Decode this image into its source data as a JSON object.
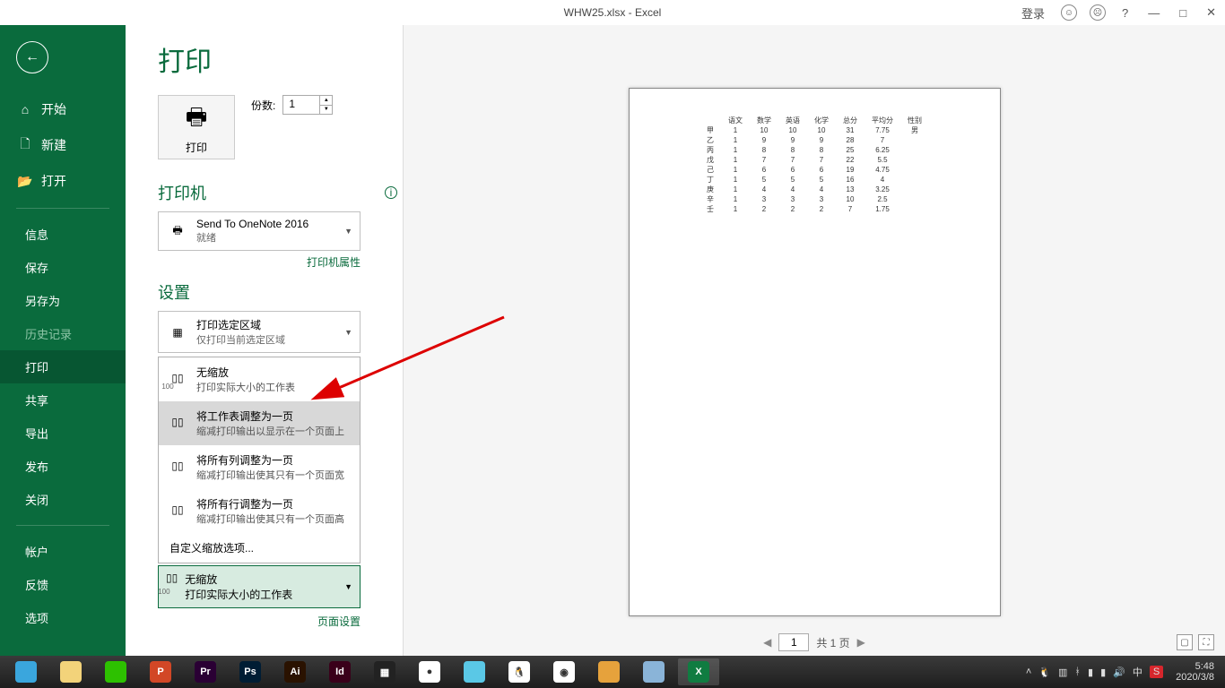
{
  "window": {
    "title": "WHW25.xlsx  -  Excel",
    "login": "登录",
    "help": "?",
    "minimize": "—",
    "restore": "□",
    "close": "✕"
  },
  "sidebar": {
    "back": "←",
    "home": "开始",
    "new": "新建",
    "open": "打开",
    "info": "信息",
    "save": "保存",
    "saveas": "另存为",
    "history": "历史记录",
    "print": "打印",
    "share": "共享",
    "export": "导出",
    "publish": "发布",
    "close": "关闭",
    "account": "帐户",
    "feedback": "反馈",
    "options": "选项"
  },
  "print": {
    "heading": "打印",
    "print_label": "打印",
    "copies_label": "份数:",
    "copies_value": "1",
    "printer_heading": "打印机",
    "printer_name": "Send To OneNote 2016",
    "printer_status": "就绪",
    "printer_props": "打印机属性",
    "settings_heading": "设置",
    "area_title": "打印选定区域",
    "area_sub": "仅打印当前选定区域",
    "scale_options": [
      {
        "title": "无缩放",
        "sub": "打印实际大小的工作表",
        "tag": "100"
      },
      {
        "title": "将工作表调整为一页",
        "sub": "缩减打印输出以显示在一个页面上",
        "tag": ""
      },
      {
        "title": "将所有列调整为一页",
        "sub": "缩减打印输出使其只有一个页面宽",
        "tag": ""
      },
      {
        "title": "将所有行调整为一页",
        "sub": "缩减打印输出使其只有一个页面高",
        "tag": ""
      }
    ],
    "scale_custom": "自定义缩放选项...",
    "scale_selected_title": "无缩放",
    "scale_selected_sub": "打印实际大小的工作表",
    "scale_selected_tag": "100",
    "page_setup": "页面设置"
  },
  "preview": {
    "page_current": "1",
    "page_total_text": "共 1 页"
  },
  "chart_data": {
    "type": "table",
    "headers": [
      "",
      "语文",
      "数学",
      "英语",
      "化学",
      "总分",
      "平均分",
      "性别"
    ],
    "rows": [
      [
        "甲",
        "1",
        "10",
        "10",
        "10",
        "31",
        "7.75",
        "男"
      ],
      [
        "乙",
        "1",
        "9",
        "9",
        "9",
        "28",
        "7",
        ""
      ],
      [
        "丙",
        "1",
        "8",
        "8",
        "8",
        "25",
        "6.25",
        ""
      ],
      [
        "戊",
        "1",
        "7",
        "7",
        "7",
        "22",
        "5.5",
        ""
      ],
      [
        "己",
        "1",
        "6",
        "6",
        "6",
        "19",
        "4.75",
        ""
      ],
      [
        "丁",
        "1",
        "5",
        "5",
        "5",
        "16",
        "4",
        ""
      ],
      [
        "庚",
        "1",
        "4",
        "4",
        "4",
        "13",
        "3.25",
        ""
      ],
      [
        "辛",
        "1",
        "3",
        "3",
        "3",
        "10",
        "2.5",
        ""
      ],
      [
        "壬",
        "1",
        "2",
        "2",
        "2",
        "7",
        "1.75",
        ""
      ]
    ]
  },
  "taskbar": {
    "items": [
      {
        "name": "browser",
        "bg": "#3aa6dd",
        "txt": ""
      },
      {
        "name": "explorer",
        "bg": "#f3d37a",
        "txt": ""
      },
      {
        "name": "wechat",
        "bg": "#2dc100",
        "txt": ""
      },
      {
        "name": "powerpoint",
        "bg": "#d24726",
        "txt": "P"
      },
      {
        "name": "premiere",
        "bg": "#2a0034",
        "txt": "Pr"
      },
      {
        "name": "photoshop",
        "bg": "#001d34",
        "txt": "Ps"
      },
      {
        "name": "illustrator",
        "bg": "#2a1200",
        "txt": "Ai"
      },
      {
        "name": "indesign",
        "bg": "#3a001a",
        "txt": "Id"
      },
      {
        "name": "video",
        "bg": "#222",
        "txt": "▦"
      },
      {
        "name": "coreldraw",
        "bg": "#fff",
        "txt": "●"
      },
      {
        "name": "app1",
        "bg": "#5ac8e6",
        "txt": ""
      },
      {
        "name": "qq",
        "bg": "#fff",
        "txt": "🐧"
      },
      {
        "name": "chrome",
        "bg": "#fff",
        "txt": "◉"
      },
      {
        "name": "app2",
        "bg": "#e6a23c",
        "txt": ""
      },
      {
        "name": "app3",
        "bg": "#8ab4d8",
        "txt": ""
      },
      {
        "name": "excel",
        "bg": "#107c41",
        "txt": "X"
      }
    ],
    "time": "5:48",
    "date": "2020/3/8"
  }
}
